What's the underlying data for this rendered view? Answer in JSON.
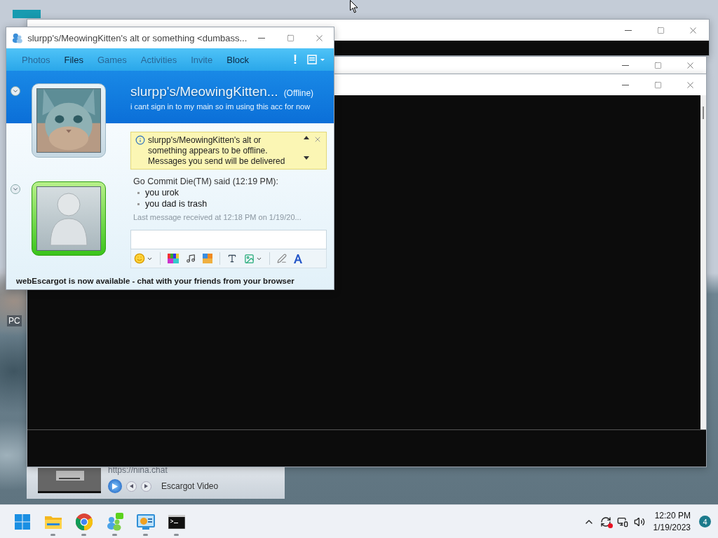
{
  "messenger": {
    "title": "slurpp's/MeowingKitten's alt or something <dumbass...",
    "toolbar": [
      {
        "label": "Photos",
        "disabled": true
      },
      {
        "label": "Files",
        "disabled": false
      },
      {
        "label": "Games",
        "disabled": true
      },
      {
        "label": "Activities",
        "disabled": true
      },
      {
        "label": "Invite",
        "disabled": true
      },
      {
        "label": "Block",
        "disabled": false
      }
    ],
    "alert": "!",
    "contact": {
      "name": "slurpp's/MeowingKitten...",
      "status": "(Offline)",
      "message": "i cant sign in to my main so im using this acc for now"
    },
    "info_bar": "slurpp's/MeowingKitten's alt or something appears to be offline. Messages you send will be delivered",
    "conversation": {
      "sender_line": "Go Commit Die(TM) said (12:19 PM):",
      "messages": [
        "you urok",
        "you dad is trash"
      ],
      "last_received": "Last message received at 12:18 PM on 1/19/20..."
    },
    "footer": "webEscargot is now available - chat with your friends from your browser"
  },
  "video_window": {
    "url": "https://nina.chat",
    "title": "Escargot Video"
  },
  "desktop_label": "PC",
  "taskbar": {
    "apps": [
      {
        "kind": "start",
        "running": false
      },
      {
        "kind": "folder",
        "running": true
      },
      {
        "kind": "chrome",
        "running": true
      },
      {
        "kind": "messenger",
        "running": true
      },
      {
        "kind": "control-panel",
        "running": true
      },
      {
        "kind": "console",
        "running": true
      }
    ],
    "time": "12:20 PM",
    "date": "1/19/2023",
    "notification_count": "4"
  }
}
